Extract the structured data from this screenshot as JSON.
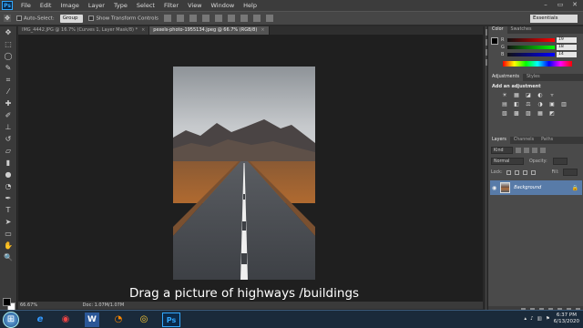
{
  "app": {
    "logo": "Ps",
    "menu": [
      "File",
      "Edit",
      "Image",
      "Layer",
      "Type",
      "Select",
      "Filter",
      "View",
      "Window",
      "Help"
    ],
    "window_controls": [
      "–",
      "▭",
      "✕"
    ]
  },
  "options": {
    "auto_select_label": "Auto-Select:",
    "auto_select_value": "Group",
    "transform_label": "Show Transform Controls",
    "workspace": "Essentials"
  },
  "tabs": [
    {
      "label": "IMG_4442.JPG @ 16.7% (Curves 1, Layer Mask/8) *",
      "active": false
    },
    {
      "label": "pexels-photo-1955134.jpeg @ 66.7% (RGB/8)",
      "active": true
    }
  ],
  "status": {
    "zoom": "66.67%",
    "doc": "Doc: 1.07M/1.07M"
  },
  "color_panel": {
    "tabs": [
      "Color",
      "Swatches"
    ],
    "sliders": [
      {
        "label": "R",
        "value": "19",
        "color": "#c33"
      },
      {
        "label": "G",
        "value": "18",
        "color": "#3a3"
      },
      {
        "label": "B",
        "value": "14",
        "color": "#33c"
      }
    ]
  },
  "adjustments_panel": {
    "tabs": [
      "Adjustments",
      "Styles"
    ],
    "title": "Add an adjustment",
    "icons": [
      "☀",
      "▦",
      "◪",
      "◐",
      "▿",
      "▤",
      "◧",
      "⚖",
      "◑",
      "▣",
      "▥",
      "▧",
      "▩",
      "▨",
      "▦",
      "◩",
      "▬",
      "◫"
    ]
  },
  "layers_panel": {
    "tabs": [
      "Layers",
      "Channels",
      "Paths"
    ],
    "kind": "Kind",
    "blend_mode": "Normal",
    "opacity_label": "Opacity:",
    "lock_label": "Lock:",
    "fill_label": "Fill:",
    "layer_name": "Background"
  },
  "caption": "Drag a picture of highways /buildings",
  "taskbar": {
    "apps": [
      "e",
      "◉",
      "W",
      "◔",
      "◎",
      "Ps"
    ],
    "time": "6:37 PM",
    "date": "6/13/2020"
  },
  "colors": {
    "menubar": "#3c3c3c",
    "canvas": "#1f1f1f",
    "layer_selected": "#587ba8",
    "ps_blue": "#31a8ff"
  }
}
